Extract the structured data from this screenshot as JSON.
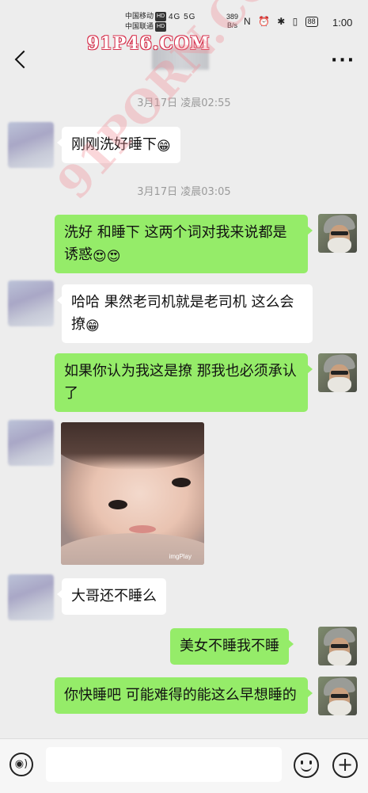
{
  "status_bar": {
    "carrier1": "中国移动",
    "carrier2": "中国联通",
    "hd_tag": "HD",
    "signals": "4G 5G",
    "net_speed_value": "389",
    "net_speed_unit": "B/s",
    "icons": "N ⏰ ✱ ▯",
    "battery": "88",
    "time": "1:00"
  },
  "watermark": {
    "top": "91P46.COM",
    "diagonal": "91PORN.COM"
  },
  "header": {
    "contact_name": ""
  },
  "messages": [
    {
      "time": "3月17日 凌晨02:55"
    },
    {
      "side": "left",
      "text": "刚刚洗好睡下",
      "emoji": "😁"
    },
    {
      "time": "3月17日 凌晨03:05"
    },
    {
      "side": "right",
      "text": "洗好 和睡下 这两个词对我来说都是诱惑",
      "emoji": "😍😍"
    },
    {
      "side": "left",
      "text": "哈哈 果然老司机就是老司机 这么会撩",
      "emoji": "😁"
    },
    {
      "side": "right",
      "text": "如果你认为我这是撩 那我也必须承认了"
    },
    {
      "side": "left",
      "type": "image",
      "tag": "imgPlay"
    },
    {
      "side": "left",
      "text": "大哥还不睡么"
    },
    {
      "side": "right",
      "text": "美女不睡我不睡"
    },
    {
      "side": "right",
      "text": "你快睡吧 可能难得的能这么早想睡的"
    }
  ],
  "input_bar": {
    "placeholder": ""
  },
  "icons": {
    "back": "back-arrow-icon",
    "more": "more-options-icon",
    "voice": "voice-icon",
    "emoji": "emoji-icon",
    "plus": "plus-icon"
  },
  "colors": {
    "background": "#ededed",
    "sent_bubble": "#95ec69",
    "received_bubble": "#ffffff",
    "watermark": "#d6324e"
  }
}
